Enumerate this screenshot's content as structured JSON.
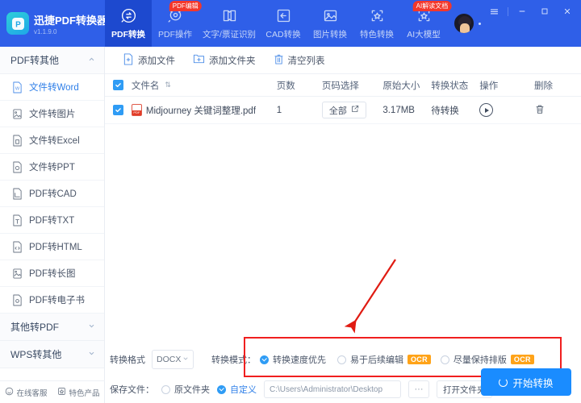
{
  "app": {
    "brand_name": "迅捷PDF转换器",
    "version": "v1.1.9.0",
    "logo_letter": "P"
  },
  "topnav": {
    "items": [
      {
        "label": "PDF转换",
        "icon": "convert-icon",
        "active": true,
        "badge": ""
      },
      {
        "label": "PDF操作",
        "icon": "gear-doc-icon",
        "active": false,
        "badge": "PDF编辑"
      },
      {
        "label": "文字/票证识别",
        "icon": "ocr-book-icon",
        "active": false,
        "badge": ""
      },
      {
        "label": "CAD转换",
        "icon": "cad-icon",
        "active": false,
        "badge": ""
      },
      {
        "label": "图片转换",
        "icon": "image-icon",
        "active": false,
        "badge": ""
      },
      {
        "label": "特色转换",
        "icon": "star-frame-icon",
        "active": false,
        "badge": ""
      },
      {
        "label": "AI大模型",
        "icon": "ai-star-icon",
        "active": false,
        "badge": "AI解读文档"
      }
    ],
    "window_controls": [
      "menu-icon",
      "minimize-icon",
      "maximize-icon",
      "close-icon"
    ]
  },
  "sidebar": {
    "group1": {
      "label": "PDF转其他",
      "expanded": true
    },
    "items": [
      {
        "label": "文件转Word",
        "icon": "word-file-icon",
        "active": true
      },
      {
        "label": "文件转图片",
        "icon": "image-file-icon",
        "active": false
      },
      {
        "label": "文件转Excel",
        "icon": "excel-file-icon",
        "active": false
      },
      {
        "label": "文件转PPT",
        "icon": "ppt-file-icon",
        "active": false
      },
      {
        "label": "PDF转CAD",
        "icon": "cad-file-icon",
        "active": false
      },
      {
        "label": "PDF转TXT",
        "icon": "txt-file-icon",
        "active": false
      },
      {
        "label": "PDF转HTML",
        "icon": "html-file-icon",
        "active": false
      },
      {
        "label": "PDF转长图",
        "icon": "longimage-file-icon",
        "active": false
      },
      {
        "label": "PDF转电子书",
        "icon": "ebook-file-icon",
        "active": false
      }
    ],
    "group2": {
      "label": "其他转PDF",
      "expanded": false
    },
    "group3": {
      "label": "WPS转其他",
      "expanded": false
    },
    "bottom": [
      {
        "label": "在线客服",
        "icon": "headset-icon"
      },
      {
        "label": "特色产品",
        "icon": "box-star-icon"
      }
    ]
  },
  "toolbar": {
    "buttons": [
      {
        "label": "添加文件",
        "icon": "add-file-icon"
      },
      {
        "label": "添加文件夹",
        "icon": "add-folder-icon"
      },
      {
        "label": "清空列表",
        "icon": "clear-list-icon"
      }
    ]
  },
  "table": {
    "header_checkbox_checked": true,
    "columns": [
      "文件名",
      "页数",
      "页码选择",
      "原始大小",
      "转换状态",
      "操作",
      "删除"
    ],
    "sort_indicator": "⇅",
    "rows": [
      {
        "checked": true,
        "file_icon": "pdf-file-icon",
        "filename": "Midjourney 关键词整理.pdf",
        "pages": "1",
        "page_select": "全部",
        "page_select_icon": "edit-square-icon",
        "size": "3.17MB",
        "status": "待转换",
        "action_icon": "play-icon",
        "delete_icon": "trash-icon"
      }
    ]
  },
  "settings": {
    "format_label": "转换格式",
    "format_value": "DOCX",
    "mode_label": "转换模式：",
    "modes": [
      {
        "label": "转换速度优先",
        "selected": true,
        "ocr": ""
      },
      {
        "label": "易于后续编辑",
        "selected": false,
        "ocr": "OCR"
      },
      {
        "label": "尽量保持排版",
        "selected": false,
        "ocr": "OCR"
      }
    ]
  },
  "save": {
    "label": "保存文件：",
    "option_original": "原文件夹",
    "option_custom": "自定义",
    "custom_selected": true,
    "path": "C:\\Users\\Administrator\\Desktop",
    "browse_label": "···",
    "open_folder_label": "打开文件夹"
  },
  "start_button": {
    "label": "开始转换",
    "icon": "spinner-icon"
  },
  "annotation": {
    "type": "red-arrow",
    "highlight": "red-rectangle"
  },
  "colors": {
    "brand_blue": "#2f5fe8",
    "active_nav": "#1d49cf",
    "accent_blue": "#1a8cff",
    "checkbox_blue": "#2f9cf5",
    "ocr_orange": "#ffa318",
    "annotation_red": "#f01f1f"
  }
}
